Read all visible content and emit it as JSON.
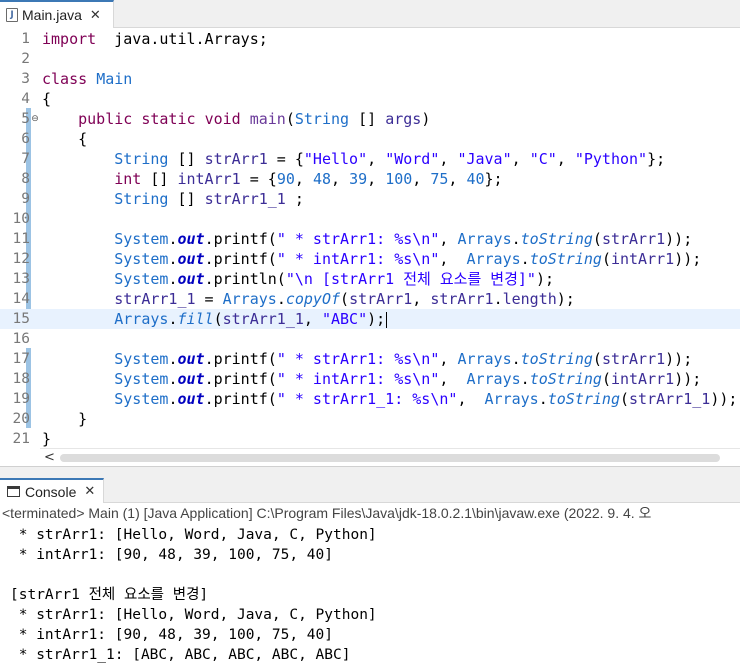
{
  "editor_tab": {
    "label": "Main.java",
    "icon": "java-file-icon",
    "close": "✕"
  },
  "code_lines": [
    {
      "n": "1",
      "parts": [
        [
          "kw",
          "import"
        ],
        [
          "",
          "  java.util.Arrays;"
        ]
      ]
    },
    {
      "n": "2",
      "parts": []
    },
    {
      "n": "3",
      "parts": [
        [
          "kw",
          "class"
        ],
        [
          "",
          " "
        ],
        [
          "ty",
          "Main"
        ]
      ]
    },
    {
      "n": "4",
      "parts": [
        [
          "",
          "{"
        ]
      ]
    },
    {
      "n": "5",
      "fold": "⊖",
      "parts": [
        [
          "",
          "    "
        ],
        [
          "kw",
          "public"
        ],
        [
          "",
          " "
        ],
        [
          "kw",
          "static"
        ],
        [
          "",
          " "
        ],
        [
          "kw",
          "void"
        ],
        [
          "",
          " "
        ],
        [
          "fn",
          "main"
        ],
        [
          "",
          "("
        ],
        [
          "ty",
          "String"
        ],
        [
          "",
          " [] "
        ],
        [
          "var",
          "args"
        ],
        [
          "",
          ")"
        ]
      ]
    },
    {
      "n": "6",
      "parts": [
        [
          "",
          "    {"
        ]
      ]
    },
    {
      "n": "7",
      "parts": [
        [
          "",
          "        "
        ],
        [
          "ty",
          "String"
        ],
        [
          "",
          " [] "
        ],
        [
          "var",
          "strArr1"
        ],
        [
          "",
          " = {"
        ],
        [
          "str",
          "\"Hello\""
        ],
        [
          "",
          ", "
        ],
        [
          "str",
          "\"Word\""
        ],
        [
          "",
          ", "
        ],
        [
          "str",
          "\"Java\""
        ],
        [
          "",
          ", "
        ],
        [
          "str",
          "\"C\""
        ],
        [
          "",
          ", "
        ],
        [
          "str",
          "\"Python\""
        ],
        [
          "",
          "};"
        ]
      ]
    },
    {
      "n": "8",
      "parts": [
        [
          "",
          "        "
        ],
        [
          "kw",
          "int"
        ],
        [
          "",
          " [] "
        ],
        [
          "var",
          "intArr1"
        ],
        [
          "",
          " = {"
        ],
        [
          "ty",
          "90"
        ],
        [
          "",
          ", "
        ],
        [
          "ty",
          "48"
        ],
        [
          "",
          ", "
        ],
        [
          "ty",
          "39"
        ],
        [
          "",
          ", "
        ],
        [
          "ty",
          "100"
        ],
        [
          "",
          ", "
        ],
        [
          "ty",
          "75"
        ],
        [
          "",
          ", "
        ],
        [
          "ty",
          "40"
        ],
        [
          "",
          "};"
        ]
      ]
    },
    {
      "n": "9",
      "parts": [
        [
          "",
          "        "
        ],
        [
          "ty",
          "String"
        ],
        [
          "",
          " [] "
        ],
        [
          "var",
          "strArr1_1"
        ],
        [
          "",
          " ;"
        ]
      ]
    },
    {
      "n": "10",
      "parts": []
    },
    {
      "n": "11",
      "parts": [
        [
          "",
          "        "
        ],
        [
          "ty",
          "System"
        ],
        [
          "",
          "."
        ],
        [
          "fld",
          "out"
        ],
        [
          "",
          ".printf("
        ],
        [
          "str",
          "\" * strArr1: %s\\n\""
        ],
        [
          "",
          ", "
        ],
        [
          "ty",
          "Arrays"
        ],
        [
          "",
          "."
        ],
        [
          "mth",
          "toString"
        ],
        [
          "",
          "("
        ],
        [
          "var",
          "strArr1"
        ],
        [
          "",
          "));"
        ]
      ]
    },
    {
      "n": "12",
      "parts": [
        [
          "",
          "        "
        ],
        [
          "ty",
          "System"
        ],
        [
          "",
          "."
        ],
        [
          "fld",
          "out"
        ],
        [
          "",
          ".printf("
        ],
        [
          "str",
          "\" * intArr1: %s\\n\""
        ],
        [
          "",
          ",  "
        ],
        [
          "ty",
          "Arrays"
        ],
        [
          "",
          "."
        ],
        [
          "mth",
          "toString"
        ],
        [
          "",
          "("
        ],
        [
          "var",
          "intArr1"
        ],
        [
          "",
          "));"
        ]
      ]
    },
    {
      "n": "13",
      "parts": [
        [
          "",
          "        "
        ],
        [
          "ty",
          "System"
        ],
        [
          "",
          "."
        ],
        [
          "fld",
          "out"
        ],
        [
          "",
          ".println("
        ],
        [
          "str",
          "\"\\n [strArr1 전체 요소를 변경]\""
        ],
        [
          "",
          ");"
        ]
      ]
    },
    {
      "n": "14",
      "parts": [
        [
          "",
          "        "
        ],
        [
          "var",
          "strArr1_1"
        ],
        [
          "",
          " = "
        ],
        [
          "ty",
          "Arrays"
        ],
        [
          "",
          "."
        ],
        [
          "mth",
          "copyOf"
        ],
        [
          "",
          "("
        ],
        [
          "var",
          "strArr1"
        ],
        [
          "",
          ", "
        ],
        [
          "var",
          "strArr1"
        ],
        [
          "",
          "."
        ],
        [
          "var",
          "length"
        ],
        [
          "",
          ");"
        ]
      ]
    },
    {
      "n": "15",
      "current": true,
      "parts": [
        [
          "",
          "        "
        ],
        [
          "ty",
          "Arrays"
        ],
        [
          "",
          "."
        ],
        [
          "mth",
          "fill"
        ],
        [
          "",
          "("
        ],
        [
          "var",
          "strArr1_1"
        ],
        [
          "",
          ", "
        ],
        [
          "str",
          "\"ABC\""
        ],
        [
          "",
          ");"
        ]
      ]
    },
    {
      "n": "16",
      "parts": []
    },
    {
      "n": "17",
      "parts": [
        [
          "",
          "        "
        ],
        [
          "ty",
          "System"
        ],
        [
          "",
          "."
        ],
        [
          "fld",
          "out"
        ],
        [
          "",
          ".printf("
        ],
        [
          "str",
          "\" * strArr1: %s\\n\""
        ],
        [
          "",
          ", "
        ],
        [
          "ty",
          "Arrays"
        ],
        [
          "",
          "."
        ],
        [
          "mth",
          "toString"
        ],
        [
          "",
          "("
        ],
        [
          "var",
          "strArr1"
        ],
        [
          "",
          "));"
        ]
      ]
    },
    {
      "n": "18",
      "parts": [
        [
          "",
          "        "
        ],
        [
          "ty",
          "System"
        ],
        [
          "",
          "."
        ],
        [
          "fld",
          "out"
        ],
        [
          "",
          ".printf("
        ],
        [
          "str",
          "\" * intArr1: %s\\n\""
        ],
        [
          "",
          ",  "
        ],
        [
          "ty",
          "Arrays"
        ],
        [
          "",
          "."
        ],
        [
          "mth",
          "toString"
        ],
        [
          "",
          "("
        ],
        [
          "var",
          "intArr1"
        ],
        [
          "",
          "));"
        ]
      ]
    },
    {
      "n": "19",
      "parts": [
        [
          "",
          "        "
        ],
        [
          "ty",
          "System"
        ],
        [
          "",
          "."
        ],
        [
          "fld",
          "out"
        ],
        [
          "",
          ".printf("
        ],
        [
          "str",
          "\" * strArr1_1: %s\\n\""
        ],
        [
          "",
          ",  "
        ],
        [
          "ty",
          "Arrays"
        ],
        [
          "",
          "."
        ],
        [
          "mth",
          "toString"
        ],
        [
          "",
          "("
        ],
        [
          "var",
          "strArr1_1"
        ],
        [
          "",
          "));"
        ]
      ]
    },
    {
      "n": "20",
      "parts": [
        [
          "",
          "    }"
        ]
      ]
    },
    {
      "n": "21",
      "parts": [
        [
          "",
          "}"
        ]
      ]
    }
  ],
  "scrollbar": {
    "left_arrow": "<"
  },
  "console_tab": {
    "label": "Console",
    "icon": "console-icon",
    "close": "✕"
  },
  "console_header": "<terminated> Main (1) [Java Application] C:\\Program Files\\Java\\jdk-18.0.2.1\\bin\\javaw.exe  (2022. 9. 4. 오",
  "console_output": [
    " * strArr1: [Hello, Word, Java, C, Python]",
    " * intArr1: [90, 48, 39, 100, 75, 40]",
    "",
    "[strArr1 전체 요소를 변경]",
    " * strArr1: [Hello, Word, Java, C, Python]",
    " * intArr1: [90, 48, 39, 100, 75, 40]",
    " * strArr1_1: [ABC, ABC, ABC, ABC, ABC]"
  ],
  "colors": {
    "accent": "#3c78b5",
    "keyword": "#7f0055",
    "string": "#2a00ff",
    "type": "#1e6ec8",
    "field": "#0000c0",
    "current_line": "#e8f2fe"
  }
}
